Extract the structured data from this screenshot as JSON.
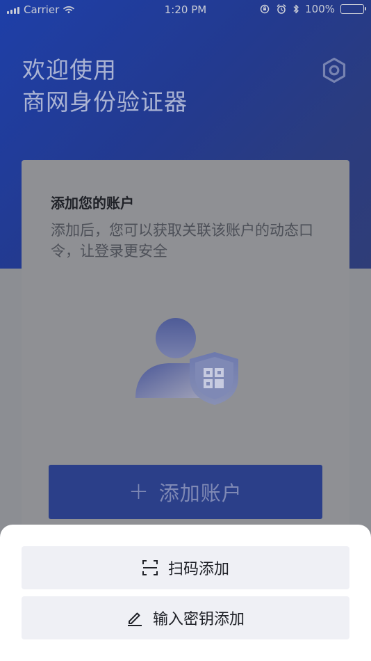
{
  "status_bar": {
    "carrier": "Carrier",
    "time": "1:20 PM",
    "battery": "100%"
  },
  "header": {
    "title_line1": "欢迎使用",
    "title_line2": "商网身份验证器"
  },
  "card": {
    "title": "添加您的账户",
    "description": "添加后，您可以获取关联该账户的动态口令，让登录更安全",
    "add_button_label": "添加账户"
  },
  "sheet": {
    "scan_label": "扫码添加",
    "key_label": "输入密钥添加"
  },
  "icons": {
    "settings": "settings-hexagon-icon",
    "plus": "plus-icon",
    "scan": "scan-icon",
    "edit": "pencil-icon"
  },
  "colors": {
    "header_gradient_start": "#1e3fa8",
    "header_gradient_end": "#2f3d78",
    "overlay_gray": "#8c8e93",
    "card_bg": "#8f9094",
    "button_blue": "#2b3f89",
    "sheet_bg": "#ffffff",
    "sheet_button_bg": "#eff0f5"
  }
}
